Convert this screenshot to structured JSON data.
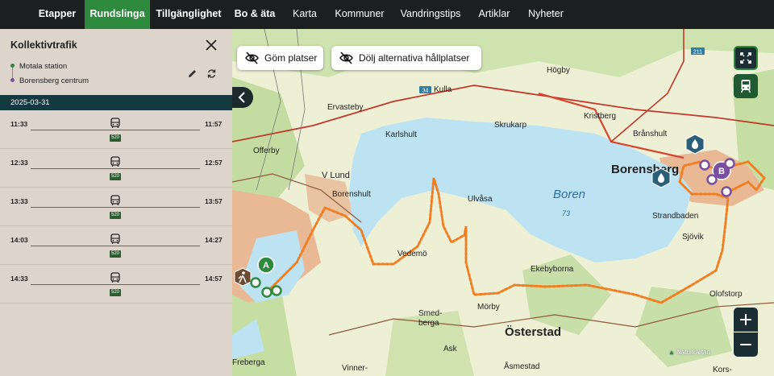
{
  "nav": {
    "items": [
      {
        "label": "Etapper"
      },
      {
        "label": "Rundslinga"
      },
      {
        "label": "Tillgänglighet"
      },
      {
        "label": "Bo & äta"
      },
      {
        "label": "Karta"
      },
      {
        "label": "Kommuner"
      },
      {
        "label": "Vandringstips"
      },
      {
        "label": "Artiklar"
      },
      {
        "label": "Nyheter"
      }
    ],
    "active_index": 1
  },
  "sidebar": {
    "title": "Kollektivtrafik",
    "from": "Motala station",
    "to": "Borensberg centrum",
    "date": "2025-03-31",
    "trips": [
      {
        "dep": "11:33",
        "arr": "11:57",
        "line": "520"
      },
      {
        "dep": "12:33",
        "arr": "12:57",
        "line": "520"
      },
      {
        "dep": "13:33",
        "arr": "13:57",
        "line": "520"
      },
      {
        "dep": "14:03",
        "arr": "14:27",
        "line": "520"
      },
      {
        "dep": "14:33",
        "arr": "14:57",
        "line": "520"
      }
    ]
  },
  "map": {
    "hide_places": "Göm platser",
    "hide_alt_stops": "Dölj alternativa hållplatser",
    "lake_name": "Boren",
    "lake_depth": "73",
    "road_34": "34",
    "road_211": "211",
    "marker_a": "A",
    "marker_b": "B",
    "attribution": "Naturkartan",
    "places": [
      "Högby",
      "Kulla",
      "Ervasteby",
      "Kristberg",
      "Karlshult",
      "Skrukarp",
      "Brånshult",
      "Offerby",
      "Borensberg",
      "V Lund",
      "Borenshult",
      "Ulvåsa",
      "Strandbaden",
      "Sjövik",
      "Vedemö",
      "Ekebyborna",
      "Olofstorp",
      "Smed-",
      "berga",
      "Mörby",
      "Österstad",
      "Ask",
      "Freberga",
      "Vinner-",
      "Åsmestad",
      "Kors-"
    ],
    "colors": {
      "route": "#f07e22",
      "lake": "#bde3f2",
      "forest": "#c7dfa5",
      "urban": "#e8b48a",
      "nav_active": "#2e8b3e",
      "dark": "#1c1f20"
    }
  }
}
